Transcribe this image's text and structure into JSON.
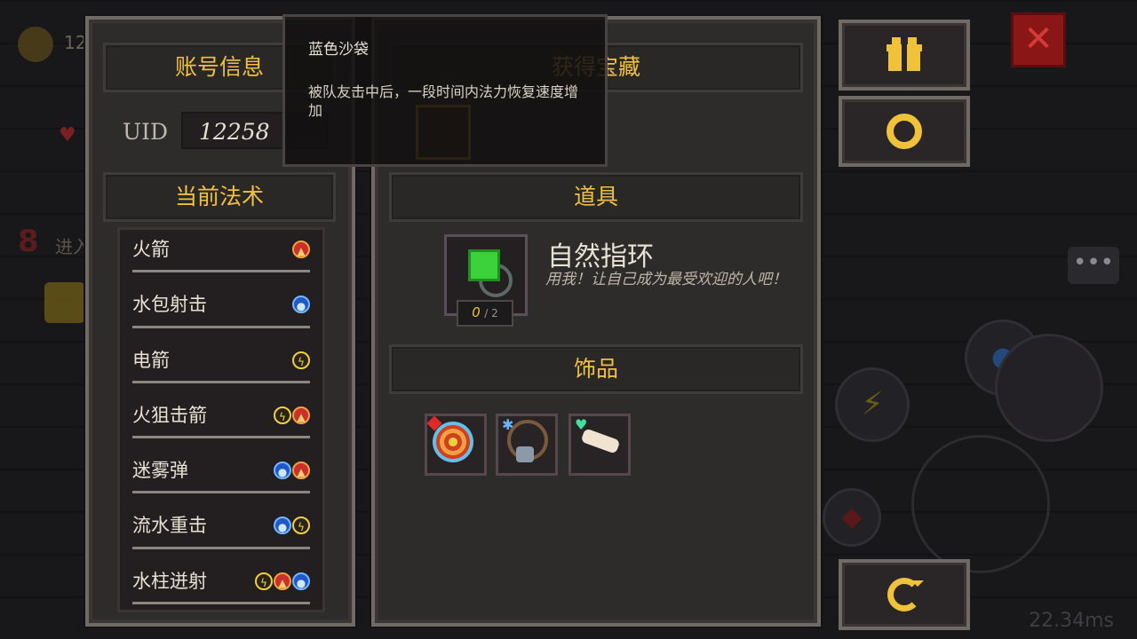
{
  "background": {
    "coin_count": "12",
    "level": "8",
    "level_text": "进入",
    "timer": "22.34ms"
  },
  "account": {
    "title": "账号信息",
    "uid_label": "UID",
    "uid_value": "12258"
  },
  "spells": {
    "title": "当前法术",
    "items": [
      {
        "name": "火箭",
        "elements": [
          "fire"
        ]
      },
      {
        "name": "水包射击",
        "elements": [
          "water"
        ]
      },
      {
        "name": "电箭",
        "elements": [
          "thunder"
        ]
      },
      {
        "name": "火狙击箭",
        "elements": [
          "thunder",
          "fire"
        ]
      },
      {
        "name": "迷雾弹",
        "elements": [
          "water",
          "fire"
        ]
      },
      {
        "name": "流水重击",
        "elements": [
          "water",
          "thunder"
        ]
      },
      {
        "name": "水柱迸射",
        "elements": [
          "thunder",
          "fire",
          "water"
        ]
      }
    ]
  },
  "treasure": {
    "title": "获得宝藏"
  },
  "props": {
    "title": "道具",
    "item_name": "自然指环",
    "item_desc": "用我！让自己成为最受欢迎的人吧！",
    "count_current": "0",
    "count_max": "/ 2"
  },
  "accessories": {
    "title": "饰品",
    "items": [
      "target-accessory",
      "necklace-accessory",
      "bone-accessory"
    ]
  },
  "tooltip": {
    "title": "蓝色沙袋",
    "desc": "被队友击中后，一段时间内法力恢复速度增加"
  },
  "icons": {
    "gift": "gift-icon",
    "settings": "gear-icon",
    "refresh": "refresh-icon",
    "close": "close-icon",
    "chat": "chat-icon"
  },
  "colors": {
    "accent_gold": "#f0c040",
    "panel_bg": "#2e2b2b",
    "close_red": "#8a1616"
  }
}
